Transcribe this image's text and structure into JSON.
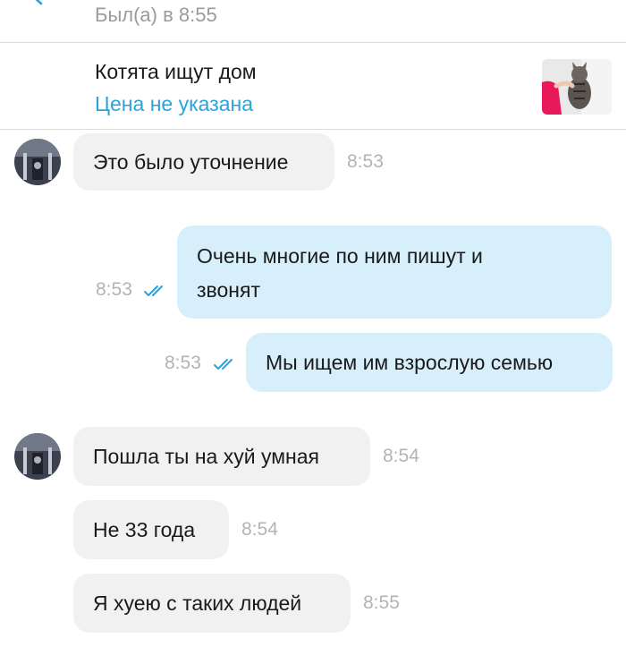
{
  "header": {
    "status": "Был(а) в 8:55"
  },
  "listing": {
    "title": "Котята ищут дом",
    "price": "Цена не указана"
  },
  "messages": [
    {
      "direction": "in",
      "text": "Это было уточнение",
      "time": "8:53"
    },
    {
      "direction": "out",
      "text_line1": "Очень многие по ним пишут и",
      "text_line2": "звонят",
      "time": "8:53",
      "read": true
    },
    {
      "direction": "out",
      "text": "Мы ищем им взрослую семью",
      "time": "8:53",
      "read": true
    },
    {
      "direction": "in",
      "text": "Пошла ты на хуй умная",
      "time": "8:54"
    },
    {
      "direction": "in",
      "text": "Не 33 года",
      "time": "8:54"
    },
    {
      "direction": "in",
      "text": "Я хуею с таких людей",
      "time": "8:55"
    }
  ],
  "colors": {
    "accent": "#2aa3dc",
    "incoming_bubble": "#f1f1f1",
    "outgoing_bubble": "#d7eefb",
    "timestamp": "#b3b3b3"
  },
  "icons": {
    "back": "chevron-left-icon",
    "read": "double-check-icon"
  }
}
